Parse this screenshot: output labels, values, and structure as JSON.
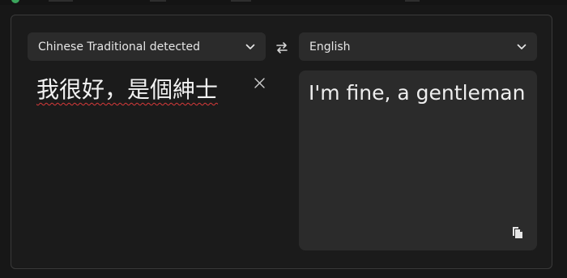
{
  "source_language": {
    "label": "Chinese Traditional detected"
  },
  "target_language": {
    "label": "English"
  },
  "source_text": "我很好，是個紳士",
  "translated_text": "I'm fine, a gentleman",
  "icons": {
    "source_dropdown": "chevron-down-icon",
    "target_dropdown": "chevron-down-icon",
    "swap": "swap-arrows-icon",
    "clear": "close-icon",
    "copy": "copy-icon"
  },
  "colors": {
    "background": "#171717",
    "panel": "#1b1b1b",
    "control": "#2b2b2b",
    "spellcheck_underline": "#d93a3a"
  }
}
